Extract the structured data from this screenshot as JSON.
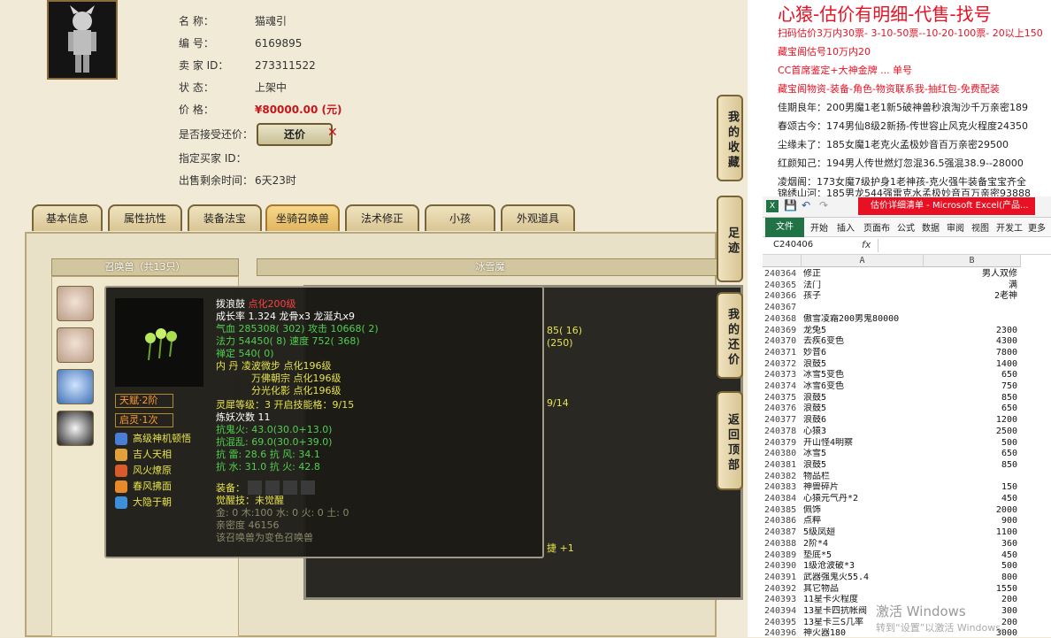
{
  "info": {
    "name_label": "名 称：",
    "name_value": "猫魂引",
    "id_label": "编 号：",
    "id_value": "6169895",
    "seller_label": "卖 家 ID：",
    "seller_value": "273311522",
    "status_label": "状 态：",
    "status_value": "上架中",
    "price_label": "价 格：",
    "price_value": "¥80000.00 (元)",
    "offer_label": "是否接受还价：",
    "offer_button": "还价",
    "buyer_label": "指定买家 ID：",
    "time_label": "出售剩余时间：",
    "time_value": "6天23时"
  },
  "tabs": [
    "基本信息",
    "属性抗性",
    "装备法宝",
    "坐骑召唤兽",
    "法术修正",
    "小孩",
    "外观道具"
  ],
  "side_buttons": [
    "我的收藏",
    "足迹",
    "我的还价",
    "返回顶部"
  ],
  "summon": {
    "list_title": "召唤兽（共13只）",
    "main_title": "冰雪魔",
    "bg_text_1": "85( 16)",
    "bg_text_2": "(250)",
    "bg_text_3": "9/14",
    "bg_text_4": "捷 +1"
  },
  "tooltip": {
    "name": "拨浪鼓",
    "name_suffix": "点化200级",
    "growth": "成长率 1.324 龙骨x3 龙涎丸x9",
    "hp": "气血 285308( 302) 攻击 10668( 2)",
    "mp": "法力 54450( 8) 速度 752( 368)",
    "zen": "禅定 540( 0)",
    "neidan_1": "内 丹 凌波微步 点化196级",
    "neidan_2": "万佛朝宗 点化196级",
    "neidan_3": "分光化影 点化196级",
    "linghe": "灵犀等级：3 开启技能格：9/15",
    "yao": "炼妖次数 11",
    "res1": "抗鬼火: 43.0(30.0+13.0)",
    "res2": "抗混乱: 69.0(30.0+39.0)",
    "res3": "抗 雷: 28.6 抗 风: 34.1",
    "res4": "抗 水: 31.0 抗 火: 42.8",
    "equip_label": "装备：",
    "awaken": "觉醒技：未觉醒",
    "elements": "金: 0 木:100 水: 0 火: 0 土: 0",
    "intimacy": "亲密度 46156",
    "variant": "该召唤兽为变色召唤兽",
    "tag1": "天赋·2阶",
    "tag2": "启灵·1次",
    "skills": [
      "高级神机顿悟",
      "吉人天相",
      "风火燎原",
      "春风拂面",
      "大隐于朝"
    ]
  },
  "notes": {
    "title": "心猿-估价有明细-代售-找号",
    "lines": [
      "扫码估价3万内30票- 3-10-50票--10-20-100票- 20以上150",
      "藏宝阁估号10万内20",
      "CC首席鉴定+大神金牌 ... 单号",
      "藏宝阁物资-装备-角色-物资联系我-抽红包-免费配装",
      "佳期良年：200男魔1老1新5破神兽秒浪淘沙千万亲密189",
      "春颂古今：174男仙8级2新扬-传世容止风克火程度24350",
      "尘缘未了：185女魔1老克火孟极妙音百万亲密29500",
      "红颜知己：194男人传世燃灯忽混36.5强混38.9--28000",
      "凌烟阁：173女魔7级护身1老神孩-克火强牛装备宝宝齐全",
      "锦绣山河：185男龙544强雷克水孟极妙音百万亲密93888"
    ]
  },
  "excel": {
    "title": "估价详细清单 - Microsoft Excel(产品...",
    "tabs": [
      "文件",
      "开始",
      "插入",
      "页面布",
      "公式",
      "数据",
      "审阅",
      "视图",
      "开发工",
      "更多"
    ],
    "name_box": "C240406",
    "fx": "fx",
    "col_a": "A",
    "col_b": "B",
    "rows": [
      [
        "240364",
        "修正",
        "男人双修"
      ],
      [
        "240365",
        "法门",
        "满"
      ],
      [
        "240366",
        "孩子",
        "2老神"
      ],
      [
        "240367",
        "",
        ""
      ],
      [
        "240368",
        "傲雪凌霜200男鬼80000",
        ""
      ],
      [
        "240369",
        "龙兔5",
        "2300"
      ],
      [
        "240370",
        "去疾6变色",
        "4300"
      ],
      [
        "240371",
        "妙音6",
        "7800"
      ],
      [
        "240372",
        "浪鼓5",
        "1400"
      ],
      [
        "240373",
        "冰雪5变色",
        "650"
      ],
      [
        "240374",
        "冰雪6变色",
        "750"
      ],
      [
        "240375",
        "浪鼓5",
        "850"
      ],
      [
        "240376",
        "浪鼓5",
        "650"
      ],
      [
        "240377",
        "浪鼓6",
        "1200"
      ],
      [
        "240378",
        "心猿3",
        "2500"
      ],
      [
        "240379",
        "开山怪4明察",
        "500"
      ],
      [
        "240380",
        "冰雪5",
        "650"
      ],
      [
        "240381",
        "浪鼓5",
        "850"
      ],
      [
        "240382",
        "物品栏",
        ""
      ],
      [
        "240383",
        "神兽碎片",
        "150"
      ],
      [
        "240384",
        "心猿元气丹*2",
        "450"
      ],
      [
        "240385",
        "佩饰",
        "2000"
      ],
      [
        "240386",
        "点粹",
        "900"
      ],
      [
        "240387",
        "5级凤翅",
        "1100"
      ],
      [
        "240388",
        "2阶*4",
        "360"
      ],
      [
        "240389",
        "垫底*5",
        "450"
      ],
      [
        "240390",
        "1级沧波破*3",
        "500"
      ],
      [
        "240391",
        "武器强鬼火55.4",
        "800"
      ],
      [
        "240392",
        "其它物品",
        "1550"
      ],
      [
        "240393",
        "11星卡火程度",
        "200"
      ],
      [
        "240394",
        "13星卡四抗帐阀",
        "300"
      ],
      [
        "240395",
        "13星卡三S几率",
        "200"
      ],
      [
        "240396",
        "神火器180",
        "3000"
      ]
    ]
  },
  "watermark": "激活 Windows",
  "watermark_sub": "转到“设置”以激活 Windows。",
  "colors": {
    "accent_red": "#e81123",
    "excel_green": "#217346",
    "price_red": "#c4161c",
    "tooltip_yellow": "#e6e34d"
  }
}
